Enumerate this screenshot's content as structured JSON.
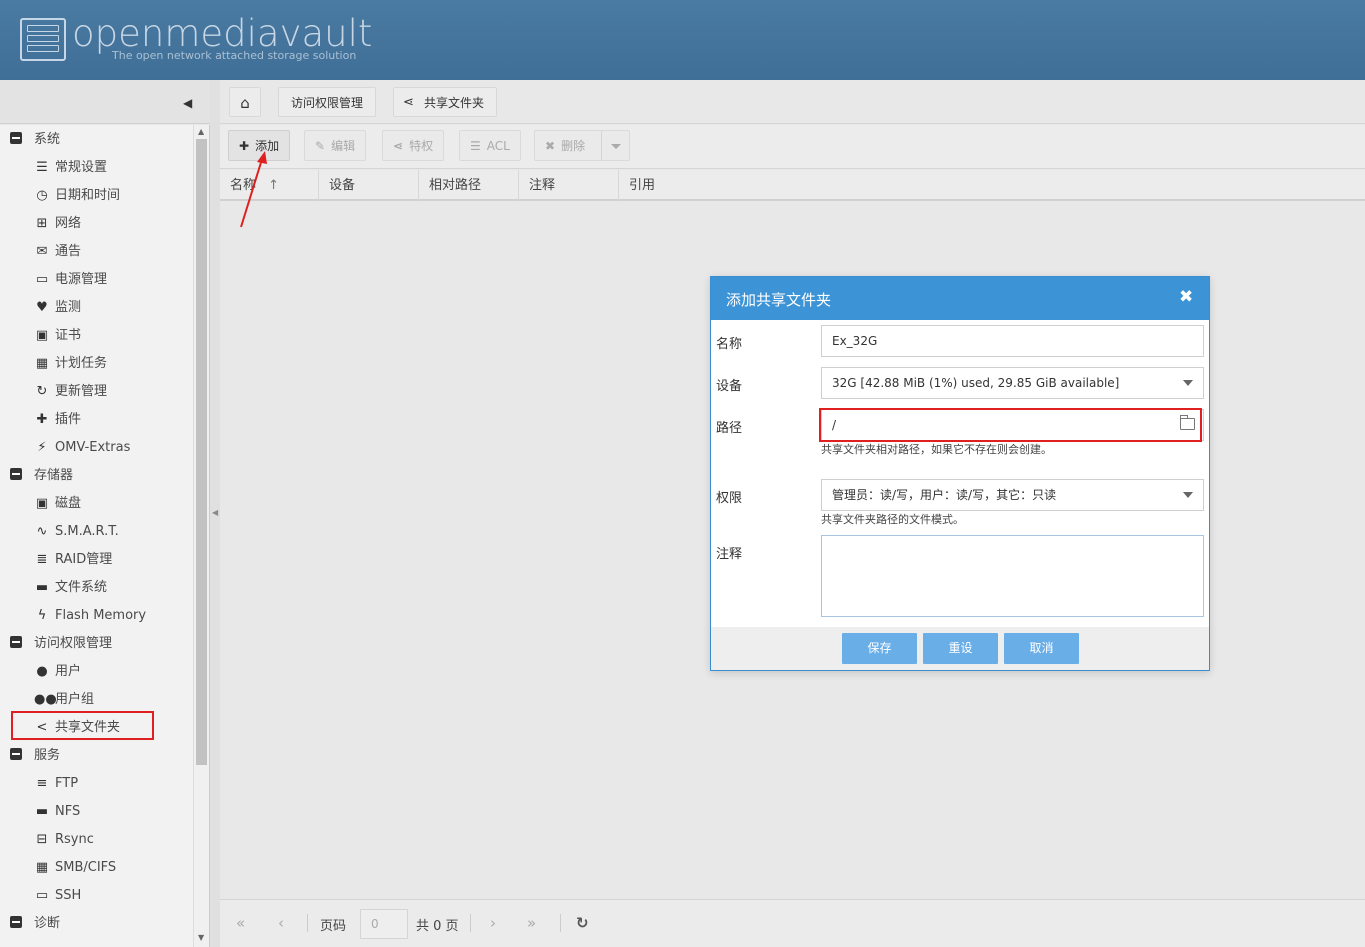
{
  "app": {
    "logo_title": "openmediavault",
    "logo_subtitle": "The open network attached storage solution"
  },
  "breadcrumb": {
    "home_icon": "home-icon",
    "items": [
      "访问权限管理",
      "共享文件夹"
    ]
  },
  "sidebar": {
    "groups": [
      {
        "label": "系统",
        "items": [
          {
            "label": "常规设置",
            "icon": "sliders-icon"
          },
          {
            "label": "日期和时间",
            "icon": "clock-icon"
          },
          {
            "label": "网络",
            "icon": "network-icon"
          },
          {
            "label": "通告",
            "icon": "envelope-icon"
          },
          {
            "label": "电源管理",
            "icon": "battery-icon"
          },
          {
            "label": "监测",
            "icon": "heartbeat-icon"
          },
          {
            "label": "证书",
            "icon": "certificate-icon"
          },
          {
            "label": "计划任务",
            "icon": "calendar-icon"
          },
          {
            "label": "更新管理",
            "icon": "refresh-icon"
          },
          {
            "label": "插件",
            "icon": "puzzle-icon"
          },
          {
            "label": "OMV-Extras",
            "icon": "plug-icon"
          }
        ]
      },
      {
        "label": "存储器",
        "items": [
          {
            "label": "磁盘",
            "icon": "disk-icon"
          },
          {
            "label": "S.M.A.R.T.",
            "icon": "pulse-icon"
          },
          {
            "label": "RAID管理",
            "icon": "database-icon"
          },
          {
            "label": "文件系统",
            "icon": "folders-icon"
          },
          {
            "label": "Flash Memory",
            "icon": "flash-icon"
          }
        ]
      },
      {
        "label": "访问权限管理",
        "items": [
          {
            "label": "用户",
            "icon": "user-icon"
          },
          {
            "label": "用户组",
            "icon": "users-icon"
          },
          {
            "label": "共享文件夹",
            "icon": "share-icon"
          }
        ]
      },
      {
        "label": "服务",
        "items": [
          {
            "label": "FTP",
            "icon": "server-icon"
          },
          {
            "label": "NFS",
            "icon": "desktop-icon"
          },
          {
            "label": "Rsync",
            "icon": "sync-network-icon"
          },
          {
            "label": "SMB/CIFS",
            "icon": "windows-icon"
          },
          {
            "label": "SSH",
            "icon": "terminal-icon"
          }
        ]
      },
      {
        "label": "诊断",
        "items": []
      }
    ]
  },
  "toolbar": {
    "add": "添加",
    "edit": "编辑",
    "privileges": "特权",
    "acl": "ACL",
    "delete": "删除"
  },
  "grid": {
    "columns": [
      "名称",
      "设备",
      "相对路径",
      "注释",
      "引用"
    ],
    "sort_indicator": "↑"
  },
  "pager": {
    "page_label": "页码",
    "page_value": "0",
    "total": "共 0 页"
  },
  "dialog": {
    "title": "添加共享文件夹",
    "close": "✖",
    "fields": {
      "name_label": "名称",
      "name_value": "Ex_32G",
      "device_label": "设备",
      "device_value": "32G [42.88 MiB (1%) used, 29.85 GiB available]",
      "path_label": "路径",
      "path_value": "/",
      "path_hint": "共享文件夹相对路径，如果它不存在则会创建。",
      "perm_label": "权限",
      "perm_value": "管理员：读/写，用户：读/写，其它：只读",
      "perm_hint": "共享文件夹路径的文件模式。",
      "comment_label": "注释"
    },
    "buttons": {
      "save": "保存",
      "reset": "重设",
      "cancel": "取消"
    }
  },
  "colors": {
    "header": "#4a7ba3",
    "dialog_header": "#3c93d6",
    "button": "#6aaee8",
    "highlight": "#e02020"
  }
}
